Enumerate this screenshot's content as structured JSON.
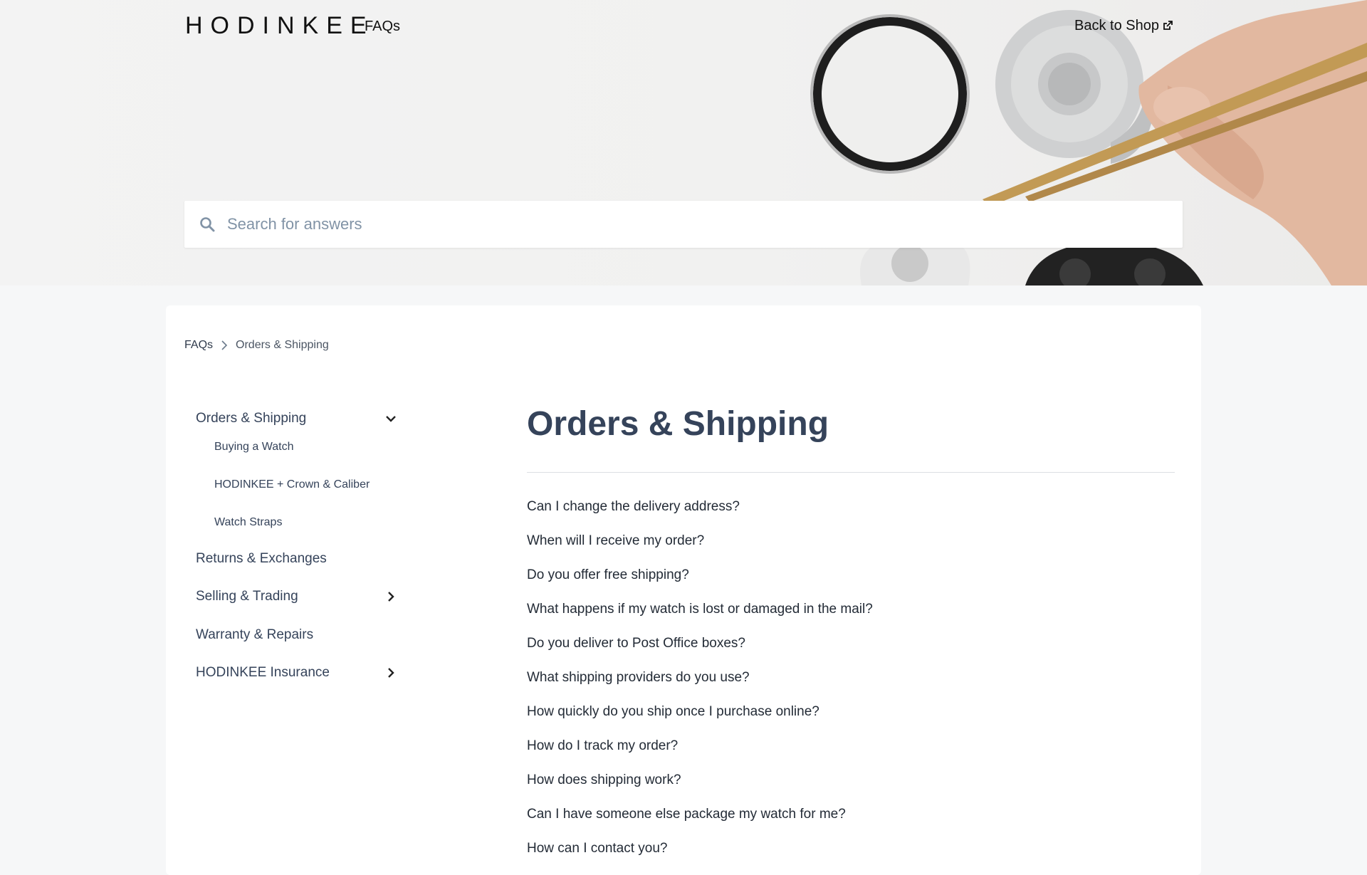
{
  "header": {
    "logo": "HODINKEE",
    "faqs_link": "FAQs",
    "back_to_shop": "Back to Shop",
    "back_to_shop_icon": "external-link-icon"
  },
  "search": {
    "placeholder": "Search for answers",
    "value": "",
    "icon": "search-icon"
  },
  "breadcrumb": {
    "items": [
      "FAQs",
      "Orders & Shipping"
    ],
    "separator_icon": "chevron-right-icon"
  },
  "sidebar": {
    "categories": [
      {
        "label": "Orders & Shipping",
        "expanded": true,
        "chevron": "chevron-down-icon"
      },
      {
        "label": "Returns & Exchanges"
      },
      {
        "label": "Selling & Trading",
        "chevron": "chevron-right-icon"
      },
      {
        "label": "Warranty & Repairs"
      },
      {
        "label": "HODINKEE Insurance",
        "chevron": "chevron-right-icon"
      }
    ],
    "subcategories": [
      "Buying a Watch",
      "HODINKEE + Crown & Caliber",
      "Watch Straps"
    ]
  },
  "main": {
    "title": "Orders & Shipping",
    "questions": [
      "Can I change the delivery address?",
      "When will I receive my order?",
      "Do you offer free shipping?",
      "What happens if my watch is lost or damaged in the mail?",
      "Do you deliver to Post Office boxes?",
      "What shipping providers do you use?",
      "How quickly do you ship once I purchase online?",
      "How do I track my order?",
      "How does shipping work?",
      "Can I have someone else package my watch for me?",
      "How can I contact you?"
    ]
  },
  "colors": {
    "accent_text": "#35435a",
    "page_background": "#f6f7f8",
    "card_background": "#ffffff"
  }
}
